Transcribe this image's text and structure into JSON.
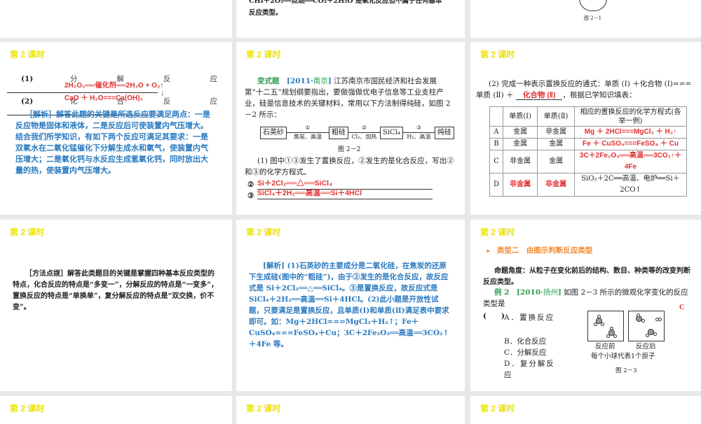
{
  "slides": {
    "top_middle": {
      "line1": "CH₄＋2O₂══点燃══CO₂＋2H₂O  是氧化反应但不属于任何基本",
      "line2": "反应类型。"
    },
    "top_right": {
      "caption": "图 2－1"
    },
    "lesson_title": "第 2 课时",
    "s1": {
      "q1_label": "(1)",
      "q1_words": [
        "分",
        "解",
        "反",
        "应"
      ],
      "q1_answer": "2H₂O₂══催化剂══2H₂O + O₂↑",
      "q2_label": "(2)",
      "q2_words": [
        "化",
        "合",
        "反",
        "应"
      ],
      "q2_answer": "CaO ＋ H₂O===Ca(OH)₂",
      "analysis": "［解析］解答此题的关键是所选反应要满足两点：一是反应物是固体和液体，二是反应后可使装置内气压增大。结合我们所学知识，有如下两个反应可满足其要求：一是双氧水在二氧化锰催化下分解生成水和氧气，使装置内气压增大；二是氧化钙与水反应生成氢氧化钙，同时放出大量的热，使装置内气压增大。"
    },
    "s2": {
      "label": "变式题",
      "source_year": "[2011·",
      "source_city": "南京",
      "source_end": "]",
      "intro": "江苏南京市国民经济和社会发展第“十二五”规划纲要指出，要做强做优电子信息等工业支柱产业，硅是信息技术的关键材料，常用以下方法制得纯硅，如图 2－2 所示：",
      "flow": {
        "nodes": [
          "石英砂",
          "粗硅",
          "SiCl₄",
          "纯硅"
        ],
        "steps": [
          {
            "num": "①",
            "cond": "焦炭、高温"
          },
          {
            "num": "②",
            "cond": "Cl₂、加热"
          },
          {
            "num": "③",
            "cond": "H₂、高温"
          }
        ],
        "caption": "图 2－2"
      },
      "question": "(1) 图中①③发生了置换反应，②发生的是化合反应，写出②和③的化学方程式。",
      "a2_label": "②",
      "a2": "Si＋2Cl₂══△══SiCl₄",
      "a3_label": "③",
      "a3": "SiCl₄＋2H₂══高温══Si＋4HCl"
    },
    "s3": {
      "question": "(2) 完成一种表示置换反应的通式：单质 (Ⅰ) ＋化合物 (Ⅰ)=== 单质 (Ⅱ) ＋",
      "blank": "化合物 (Ⅱ)",
      "after": "，根据已学知识填表：",
      "headers": [
        "",
        "单质(Ⅰ)",
        "单质(Ⅱ)",
        "相应的置换反应的化学方程式(各举一例)"
      ],
      "rows": [
        [
          "A",
          "金属",
          "非金属",
          "Mg ＋ 2HCl===MgCl₂ ＋ H₂↑"
        ],
        [
          "B",
          "金属",
          "金属",
          "Fe ＋ CuSO₄===FeSO₄ ＋ Cu"
        ],
        [
          "C",
          "非金属",
          "金属",
          "3C＋2Fe₂O₃══高温══3CO₂↑＋4Fe"
        ],
        [
          "D",
          "非金属",
          "非金属",
          "SiO₂＋2C══高温、电炉══Si＋2CO↑"
        ]
      ]
    },
    "s4": {
      "text": "［方法点拨］解答此类题目的关键是掌握四种基本反应类型的特点，化合反应的特点是“多变一”，分解反应的特点是“一变多”，置换反应的特点是“单换单”，复分解反应的特点是“双交换，价不变”。"
    },
    "s5": {
      "text": "[解析] (1)石英砂的主要成分是二氧化硅，在焦炭的还原下生成硅(图中的“粗硅”)，由于②发生的是化合反应，故反应式是 Si＋2Cl₂══△══SiCl₄。③是置换反应，故反应式是 SiCl₄＋2H₂══高温══Si＋4HCl。(2)此小题是开放性试题，只要满足是置换反应，且单质(Ⅰ)和单质(Ⅱ)满足表中要求即可。如：Mg＋2HCl===MgCl₂＋H₂↑；Fe＋CuSO₄===FeSO₄＋Cu；3C＋2Fe₂O₃══高温══3CO₂↑＋4Fe 等。"
    },
    "s6": {
      "heading": "类型二　由图示判断反应类型",
      "angle": "命题角度：从粒子在变化前后的结构、数目、种类等的改变判断反应类型。",
      "ex_label": "例 2",
      "source_year": "[2010·",
      "source_city": "扬州",
      "source_end": "]",
      "ex_text": "如图 2－3 所示的微观化学变化的反应类型是",
      "paren": "(　　)",
      "answer": "C",
      "options": [
        "A．置换反应",
        "B．化合反应",
        "C．分解反应",
        "D．复分解反应"
      ],
      "before": "反应前",
      "after": "反应后",
      "note": "每个小球代表1个原子",
      "caption": "图 2－3"
    }
  }
}
